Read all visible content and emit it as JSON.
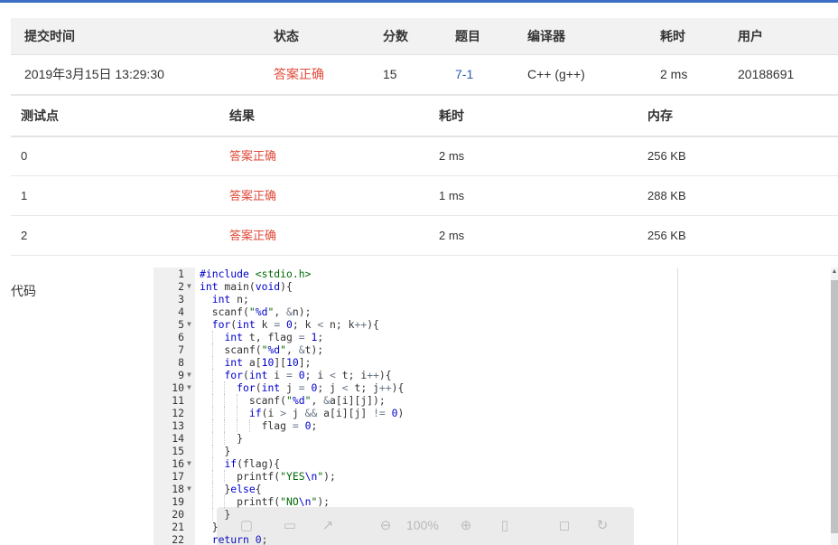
{
  "submission": {
    "headers": [
      "提交时间",
      "状态",
      "分数",
      "题目",
      "编译器",
      "耗时",
      "用户"
    ],
    "row": {
      "time": "2019年3月15日 13:29:30",
      "status": "答案正确",
      "score": "15",
      "problem": "7-1",
      "compiler": "C++ (g++)",
      "duration": "2 ms",
      "user": "20188691"
    }
  },
  "tests": {
    "headers": [
      "测试点",
      "结果",
      "耗时",
      "内存"
    ],
    "rows": [
      {
        "id": "0",
        "result": "答案正确",
        "time": "2 ms",
        "memory": "256 KB"
      },
      {
        "id": "1",
        "result": "答案正确",
        "time": "1 ms",
        "memory": "288 KB"
      },
      {
        "id": "2",
        "result": "答案正确",
        "time": "2 ms",
        "memory": "256 KB"
      }
    ]
  },
  "code_section": {
    "label": "代码",
    "line_numbers": [
      "1",
      "2",
      "3",
      "4",
      "5",
      "6",
      "7",
      "8",
      "9",
      "10",
      "11",
      "12",
      "13",
      "14",
      "15",
      "16",
      "17",
      "18",
      "19",
      "20",
      "21",
      "22"
    ],
    "lines": [
      "#include <stdio.h>",
      "int main(void){",
      "  int n;",
      "  scanf(\"%d\", &n);",
      "  for(int k = 0; k < n; k++){",
      "    int t, flag = 1;",
      "    scanf(\"%d\", &t);",
      "    int a[10][10];",
      "    for(int i = 0; i < t; i++){",
      "      for(int j = 0; j < t; j++){",
      "        scanf(\"%d\", &a[i][j]);",
      "        if(i > j && a[i][j] != 0)",
      "          flag = 0;",
      "      }",
      "    }",
      "    if(flag){",
      "      printf(\"YES\\n\");",
      "    }else{",
      "      printf(\"NO\\n\");",
      "    }",
      "  }",
      "  return 0;"
    ],
    "foldable_lines": [
      2,
      5,
      9,
      10,
      16,
      18
    ]
  },
  "image_toolbar": {
    "zoom": "100%",
    "icons": [
      "save-icon",
      "comment-icon",
      "share-icon",
      "zoom-out-icon",
      "zoom-in-icon",
      "fit-icon",
      "fullscreen-icon",
      "rotate-icon"
    ]
  },
  "colors": {
    "accent": "#3b6ec4",
    "status_ok": "#e04a3a",
    "link": "#2b5fa8",
    "keyword": "#0000cc",
    "string": "#036a07"
  }
}
